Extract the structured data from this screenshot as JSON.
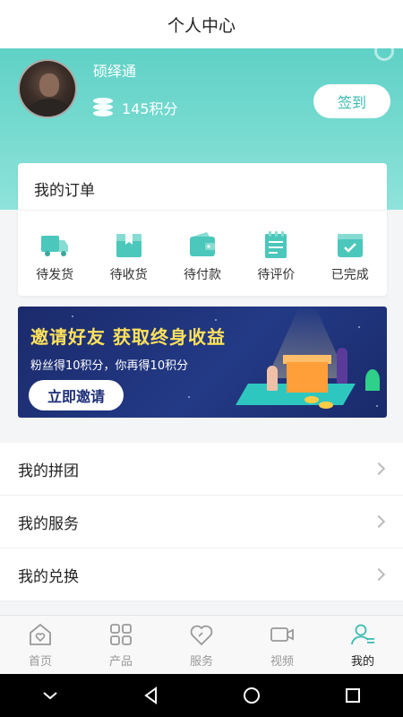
{
  "header": {
    "title": "个人中心"
  },
  "profile": {
    "name": "硕绎通",
    "points": "145积分",
    "signin_label": "签到"
  },
  "orders": {
    "title": "我的订单",
    "items": [
      {
        "label": "待发货",
        "icon": "truck-icon"
      },
      {
        "label": "待收货",
        "icon": "package-icon"
      },
      {
        "label": "待付款",
        "icon": "wallet-icon"
      },
      {
        "label": "待评价",
        "icon": "notepad-icon"
      },
      {
        "label": "已完成",
        "icon": "calendar-check-icon"
      }
    ]
  },
  "banner": {
    "title": "邀请好友  获取终身收益",
    "subtitle": "粉丝得10积分，你再得10积分",
    "button": "立即邀请"
  },
  "menu": {
    "items": [
      {
        "label": "我的拼团"
      },
      {
        "label": "我的服务"
      },
      {
        "label": "我的兑换"
      }
    ]
  },
  "tabbar": {
    "tabs": [
      {
        "label": "首页",
        "icon": "home-heart-icon"
      },
      {
        "label": "产品",
        "icon": "grid-icon"
      },
      {
        "label": "服务",
        "icon": "heart-icon"
      },
      {
        "label": "视频",
        "icon": "video-camera-icon"
      },
      {
        "label": "我的",
        "icon": "user-icon",
        "active": true
      }
    ]
  },
  "colors": {
    "accent": "#5fd1c6",
    "banner_title": "#ffe25a",
    "banner_bg": "#1b2a6b"
  }
}
